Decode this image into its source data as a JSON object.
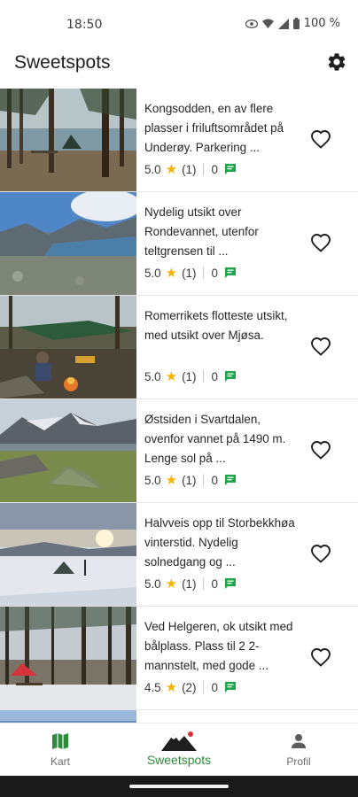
{
  "status_bar": {
    "time": "18:50",
    "battery": "100 %"
  },
  "app_bar": {
    "title": "Sweetspots",
    "settings_icon": "gear-icon"
  },
  "spots": [
    {
      "text": "Kongsodden, en av flere plasser i friluftsområdet på Underøy. Parkering ...",
      "rating": "5.0",
      "rating_count": "(1)",
      "comments": "0",
      "image": "camp-forest-lake"
    },
    {
      "text": "Nydelig utsikt over Rondevannet, utenfor teltgrensen til ...",
      "rating": "5.0",
      "rating_count": "(1)",
      "comments": "0",
      "image": "mountain-lake-view"
    },
    {
      "text": "Romerrikets flotteste utsikt, med utsikt over Mjøsa.",
      "rating": "5.0",
      "rating_count": "(1)",
      "comments": "0",
      "image": "hammock-campfire"
    },
    {
      "text": "Østsiden i Svartdalen, ovenfor vannet på 1490 m. Lenge sol på ...",
      "rating": "5.0",
      "rating_count": "(1)",
      "comments": "0",
      "image": "tent-mountain-valley"
    },
    {
      "text": "Halvveis opp til Storbekkhøa vinterstid. Nydelig solnedgang og ...",
      "rating": "5.0",
      "rating_count": "(1)",
      "comments": "0",
      "image": "winter-sunset-tent"
    },
    {
      "text": "Ved Helgeren, ok utsikt med bålplass. Plass til 2 2-mannstelt, med gode ...",
      "rating": "4.5",
      "rating_count": "(2)",
      "comments": "0",
      "image": "red-tent-forest"
    }
  ],
  "bottom_nav": [
    {
      "label": "Kart",
      "icon": "map-icon"
    },
    {
      "label": "Sweetspots",
      "icon": "mountain-logo-icon"
    },
    {
      "label": "Profil",
      "icon": "person-icon"
    }
  ],
  "colors": {
    "accent": "#2e8b3c",
    "star": "#f4b400",
    "comment": "#1fa64a"
  }
}
